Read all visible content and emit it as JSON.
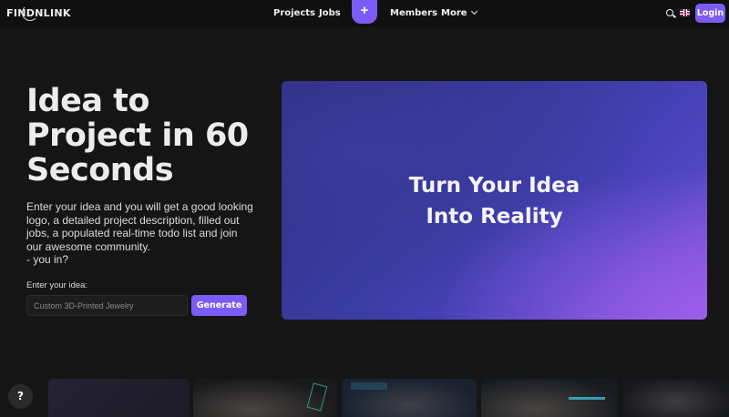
{
  "nav": {
    "logo": "FINDNLINK",
    "links": {
      "projects": "Projects",
      "jobs": "Jobs",
      "members": "Members",
      "more": "More"
    },
    "plus_label": "+",
    "login_label": "Login",
    "icons": {
      "search": "search-icon",
      "language": "uk-flag-icon",
      "more": "chevron-down-icon"
    }
  },
  "hero": {
    "title": "Idea to Project in 60 Seconds",
    "description_lines": [
      "Enter your idea and you will get a good looking",
      "logo, a detailed project description, filled out",
      "jobs, a populated real-time todo list and join",
      "our awesome community.",
      "- you in?"
    ],
    "input_label": "Enter your idea:",
    "input_placeholder": "Custom 3D-Printed Jewelry",
    "generate_label": "Generate",
    "card_line1": "Turn Your Idea",
    "card_line2": "Into Reality"
  },
  "help": {
    "label": "?"
  },
  "colors": {
    "accent": "#7b5cf6",
    "background": "#151515"
  }
}
